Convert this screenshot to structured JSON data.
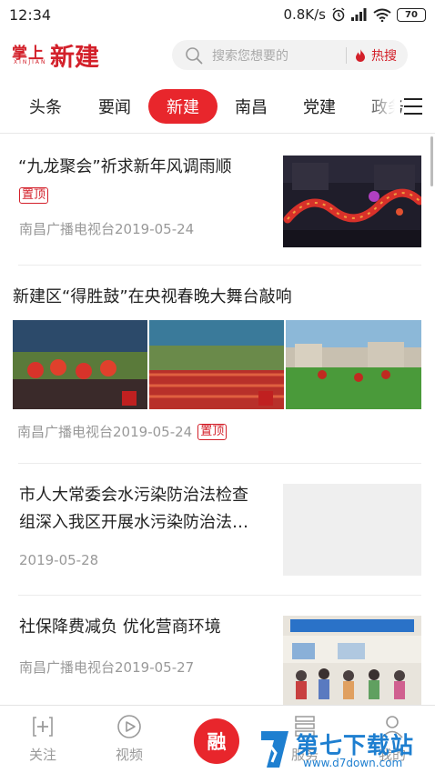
{
  "status_bar": {
    "time": "12:34",
    "speed": "0.8K/s",
    "battery": "70"
  },
  "header": {
    "logo_small": "掌上",
    "logo_big": "新建",
    "logo_sub": "XINJIAN",
    "search_placeholder": "搜索您想要的",
    "hot_label": "热搜"
  },
  "tabs": [
    {
      "label": "头条"
    },
    {
      "label": "要闻"
    },
    {
      "label": "新建",
      "active": true
    },
    {
      "label": "南昌"
    },
    {
      "label": "党建"
    },
    {
      "label": "政务"
    }
  ],
  "feed": [
    {
      "title": "“九龙聚会”祈求新年风调雨顺",
      "badge": "置顶",
      "source": "南昌广播电视台",
      "date": "2019-05-24"
    },
    {
      "title": "新建区“得胜鼓”在央视春晚大舞台敲响",
      "badge": "置顶",
      "source": "南昌广播电视台",
      "date": "2019-05-24"
    },
    {
      "title_line1": "市人大常委会水污染防治法检查",
      "title_line2": "组深入我区开展水污染防治法…",
      "date": "2019-05-28"
    },
    {
      "title": "社保降费减负 优化营商环境",
      "source": "南昌广播电视台",
      "date": "2019-05-27"
    }
  ],
  "bottom_nav": {
    "follow": "关注",
    "video": "视频",
    "center": "融",
    "service": "服务",
    "mine": "我的"
  },
  "watermark": {
    "text": "第七下载站",
    "url": "www.d7down.com"
  },
  "colors": {
    "brand_red": "#e8262c",
    "meta_gray": "#999999",
    "watermark_blue": "#1e7fd0"
  }
}
